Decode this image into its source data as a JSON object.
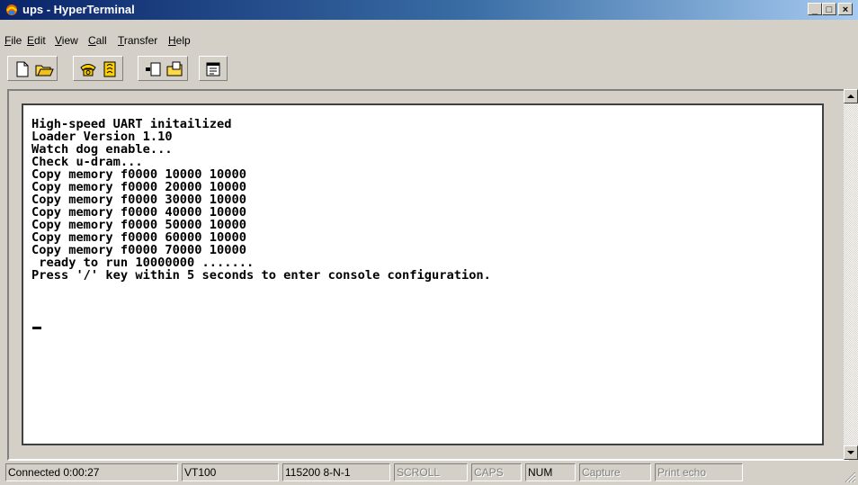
{
  "window": {
    "title": "ups - HyperTerminal",
    "controls": {
      "minimize": "_",
      "maximize": "□",
      "close": "×"
    }
  },
  "menu": {
    "items": [
      {
        "label": "File",
        "mnemonic": "F"
      },
      {
        "label": "Edit",
        "mnemonic": "E"
      },
      {
        "label": "View",
        "mnemonic": "V"
      },
      {
        "label": "Call",
        "mnemonic": "C"
      },
      {
        "label": "Transfer",
        "mnemonic": "T"
      },
      {
        "label": "Help",
        "mnemonic": "H"
      }
    ]
  },
  "toolbar": {
    "buttons": [
      {
        "name": "new-connection",
        "icon": "new-document-icon"
      },
      {
        "name": "open",
        "icon": "open-folder-icon"
      },
      {
        "name": "call",
        "icon": "phone-icon"
      },
      {
        "name": "disconnect",
        "icon": "disconnect-phone-icon"
      },
      {
        "name": "send",
        "icon": "send-file-icon"
      },
      {
        "name": "receive",
        "icon": "receive-file-icon"
      },
      {
        "name": "properties",
        "icon": "properties-icon"
      }
    ]
  },
  "terminal": {
    "lines": [
      "High-speed UART initailized",
      "Loader Version 1.10",
      "Watch dog enable...",
      "Check u-dram...",
      "Copy memory f0000 10000 10000",
      "Copy memory f0000 20000 10000",
      "Copy memory f0000 30000 10000",
      "Copy memory f0000 40000 10000",
      "Copy memory f0000 50000 10000",
      "Copy memory f0000 60000 10000",
      "Copy memory f0000 70000 10000",
      " ready to run 10000000 .......",
      "Press '/' key within 5 seconds to enter console configuration."
    ],
    "cursor": "_"
  },
  "statusbar": {
    "connected": "Connected 0:00:27",
    "emulation": "VT100",
    "settings": "115200 8-N-1",
    "scroll": "SCROLL",
    "caps": "CAPS",
    "num": "NUM",
    "capture": "Capture",
    "print_echo": "Print echo"
  },
  "colors": {
    "titlebar_start": "#0a246a",
    "titlebar_end": "#a6caf0",
    "face": "#d4d0c8",
    "terminal_bg": "#ffffff",
    "terminal_fg": "#000000",
    "disabled_text": "#808080"
  }
}
